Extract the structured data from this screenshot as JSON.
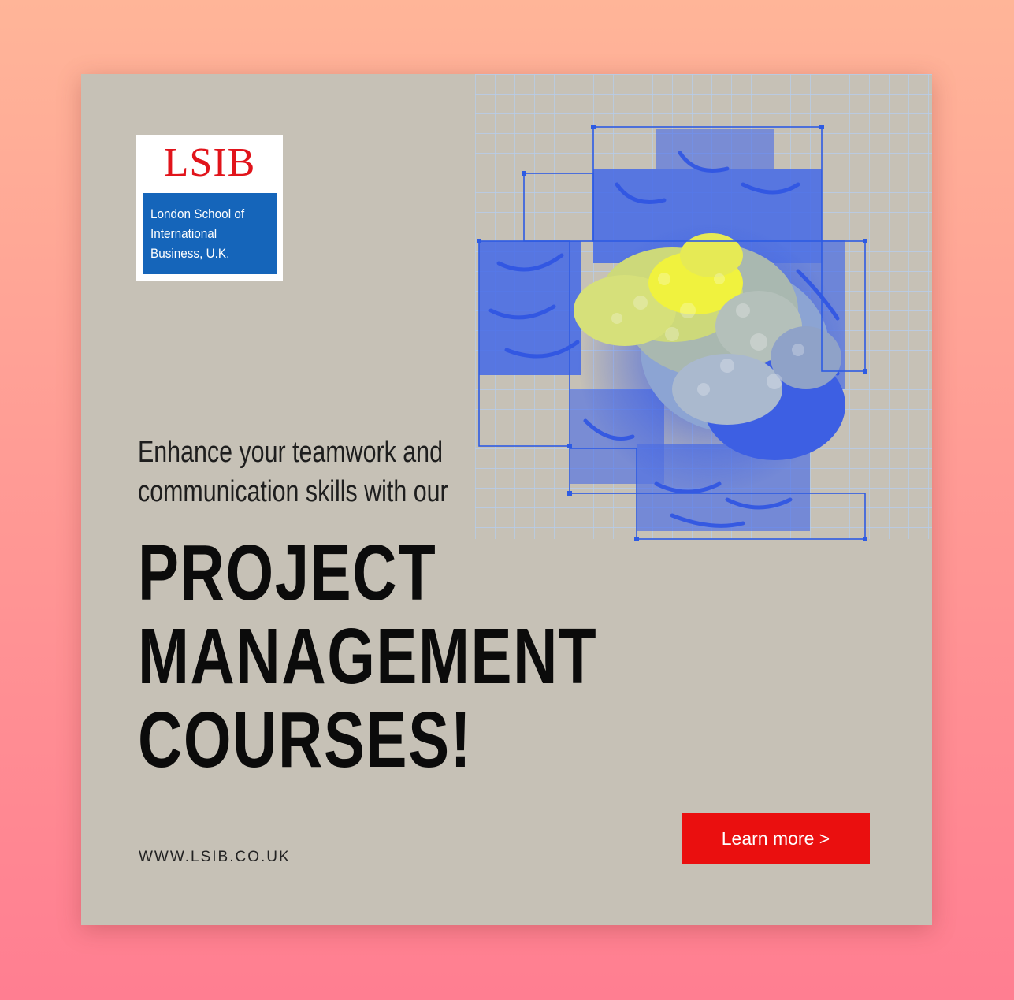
{
  "logo": {
    "wordmark": "LSIB",
    "panel_lines": [
      "London School of",
      "International",
      "Business, U.K."
    ]
  },
  "tagline": {
    "lines": [
      "Enhance your teamwork and",
      "communication skills with our"
    ]
  },
  "headline": {
    "lines": [
      "PROJECT",
      "MANAGEMENT",
      "COURSES!"
    ]
  },
  "website": "WWW.LSIB.CO.UK",
  "cta": {
    "label": "Learn more >"
  },
  "colors": {
    "background_top": "#FFB598",
    "background_bottom": "#FF7E91",
    "card": "#C6C1B6",
    "brand_red": "#E1141B",
    "brand_blue": "#1565BA",
    "cta_red": "#EA0F0F",
    "coral_yellow": "#E4E850",
    "coral_blue": "#3A63E8",
    "grid_line": "#AFCBF2"
  },
  "images": {
    "hero": "coral-sculpture-on-grid"
  }
}
